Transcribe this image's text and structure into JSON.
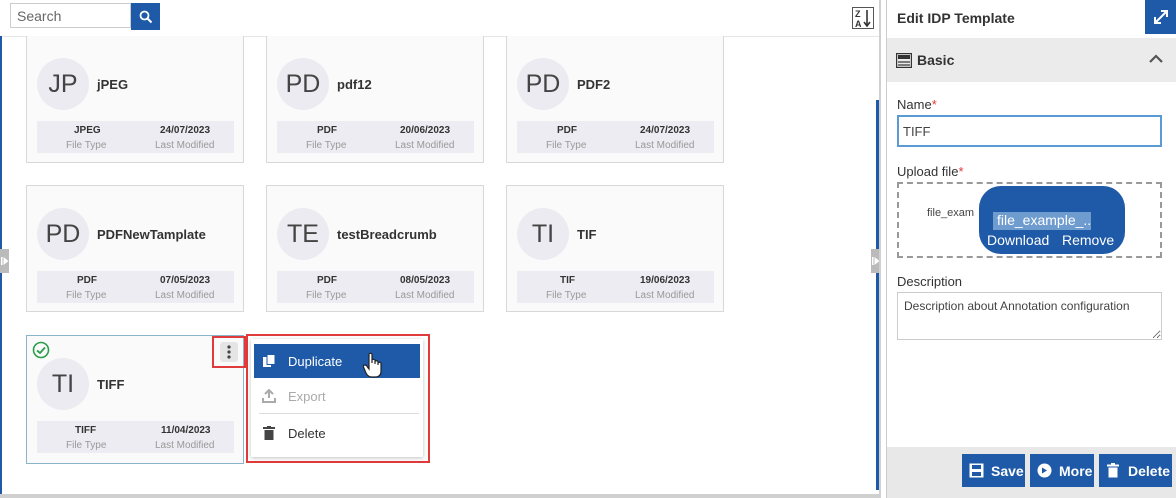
{
  "search": {
    "placeholder": "Search",
    "value": ""
  },
  "cards": [
    {
      "initials": "JP",
      "name": "jPEG",
      "file_type": "JPEG",
      "last_modified": "24/07/2023"
    },
    {
      "initials": "PD",
      "name": "pdf12",
      "file_type": "PDF",
      "last_modified": "20/06/2023"
    },
    {
      "initials": "PD",
      "name": "PDF2",
      "file_type": "PDF",
      "last_modified": "24/07/2023"
    },
    {
      "initials": "PD",
      "name": "PDFNewTamplate",
      "file_type": "PDF",
      "last_modified": "07/05/2023"
    },
    {
      "initials": "TE",
      "name": "testBreadcrumb",
      "file_type": "PDF",
      "last_modified": "08/05/2023"
    },
    {
      "initials": "TI",
      "name": "TIF",
      "file_type": "TIF",
      "last_modified": "19/06/2023"
    },
    {
      "initials": "TI",
      "name": "TIFF",
      "file_type": "TIFF",
      "last_modified": "11/04/2023"
    }
  ],
  "labels": {
    "file_type": "File Type",
    "last_modified": "Last Modified"
  },
  "context_menu": {
    "duplicate": "Duplicate",
    "export": "Export",
    "delete": "Delete"
  },
  "panel": {
    "title": "Edit IDP Template",
    "section": "Basic",
    "name_label": "Name",
    "name_value": "TIFF",
    "upload_label": "Upload file",
    "upload_text": "file_exam",
    "file_name": "file_example_...",
    "download": "Download",
    "remove": "Remove",
    "description_label": "Description",
    "description_value": "Description about Annotation configuration",
    "required_mark": "*"
  },
  "footer": {
    "save": "Save",
    "more": "More",
    "delete": "Delete"
  },
  "colors": {
    "accent": "#1e5aa7",
    "highlight_border": "#e03a3a",
    "selected_check": "#2a9d4a"
  }
}
